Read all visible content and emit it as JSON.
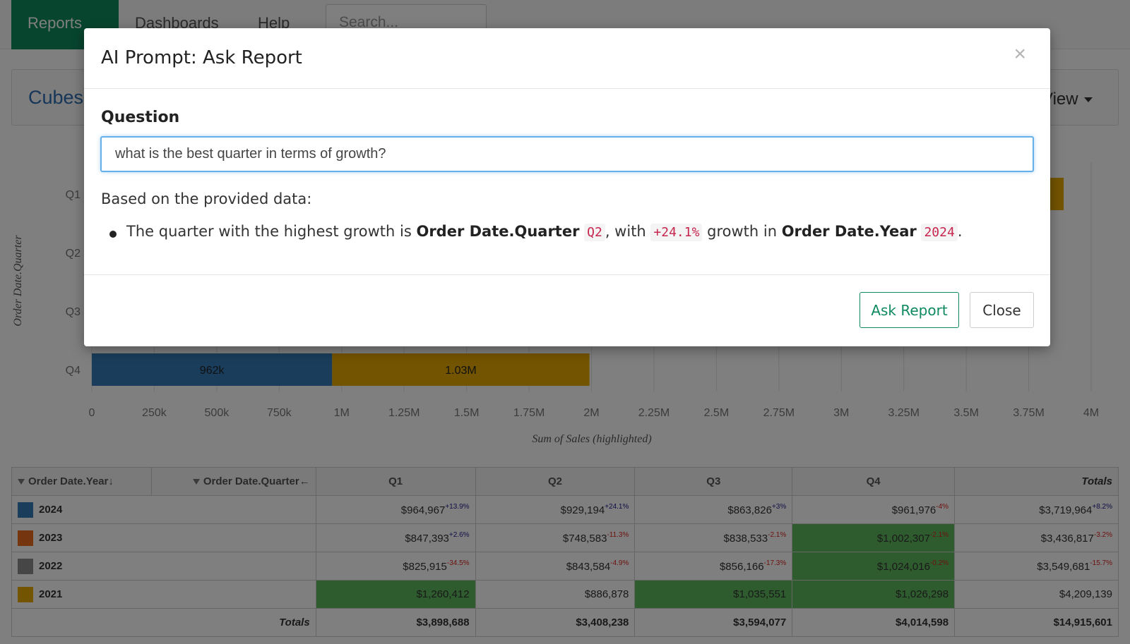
{
  "nav": {
    "reports": "Reports",
    "dashboards": "Dashboards",
    "help": "Help",
    "search_placeholder": "Search..."
  },
  "panel": {
    "title": "Cubes",
    "view_menu": "View"
  },
  "chart_data": {
    "type": "bar",
    "orientation": "horizontal",
    "stacked": true,
    "categories": [
      "Q1",
      "Q2",
      "Q3",
      "Q4"
    ],
    "ylabel": "Order Date.Quarter",
    "xlabel": "Sum of Sales (highlighted)",
    "xlim": [
      0,
      4000000
    ],
    "xticks": [
      "0",
      "250k",
      "500k",
      "750k",
      "1M",
      "1.25M",
      "1.5M",
      "1.75M",
      "2M",
      "2.25M",
      "2.5M",
      "2.75M",
      "3M",
      "3.25M",
      "3.5M",
      "3.75M",
      "4M"
    ],
    "grid": true,
    "series": [
      {
        "values": [
          null,
          null,
          null,
          962000
        ],
        "labels": [
          "",
          "",
          "",
          "962k"
        ],
        "color": "#337ab7"
      },
      {
        "values": [
          null,
          null,
          null,
          1030000
        ],
        "labels": [
          "",
          "",
          "",
          "1.03M"
        ],
        "color": "#e6a800"
      }
    ],
    "q1_right_edge_visible_value": 3890000
  },
  "table": {
    "header": {
      "year_label": "Order Date.Year",
      "year_sort": "↓",
      "quarter_label": "Order Date.Quarter",
      "quarter_sort": "←",
      "cols": [
        "Q1",
        "Q2",
        "Q3",
        "Q4"
      ],
      "totals": "Totals"
    },
    "rows": [
      {
        "year": "2024",
        "color": "#337ab7",
        "cells": [
          {
            "value": "$964,967",
            "delta": "+13.9%",
            "sign": "pos",
            "highlight": false
          },
          {
            "value": "$929,194",
            "delta": "+24.1%",
            "sign": "pos",
            "highlight": false
          },
          {
            "value": "$863,826",
            "delta": "+3%",
            "sign": "pos",
            "highlight": false
          },
          {
            "value": "$961,976",
            "delta": "-4%",
            "sign": "neg",
            "highlight": false
          },
          {
            "value": "$3,719,964",
            "delta": "+8.2%",
            "sign": "pos",
            "highlight": false
          }
        ]
      },
      {
        "year": "2023",
        "color": "#e86b1f",
        "cells": [
          {
            "value": "$847,393",
            "delta": "+2.6%",
            "sign": "pos",
            "highlight": false
          },
          {
            "value": "$748,583",
            "delta": "-11.3%",
            "sign": "neg",
            "highlight": false
          },
          {
            "value": "$838,533",
            "delta": "-2.1%",
            "sign": "neg",
            "highlight": false
          },
          {
            "value": "$1,002,307",
            "delta": "-2.1%",
            "sign": "neg",
            "highlight": true
          },
          {
            "value": "$3,436,817",
            "delta": "-3.2%",
            "sign": "neg",
            "highlight": false
          }
        ]
      },
      {
        "year": "2022",
        "color": "#8c8c8c",
        "cells": [
          {
            "value": "$825,915",
            "delta": "-34.5%",
            "sign": "neg",
            "highlight": false
          },
          {
            "value": "$843,584",
            "delta": "-4.9%",
            "sign": "neg",
            "highlight": false
          },
          {
            "value": "$856,166",
            "delta": "-17.3%",
            "sign": "neg",
            "highlight": false
          },
          {
            "value": "$1,024,016",
            "delta": "-0.2%",
            "sign": "neg",
            "highlight": true
          },
          {
            "value": "$3,549,681",
            "delta": "-15.7%",
            "sign": "neg",
            "highlight": false
          }
        ]
      },
      {
        "year": "2021",
        "color": "#e6a800",
        "cells": [
          {
            "value": "$1,260,412",
            "delta": "",
            "sign": "",
            "highlight": true
          },
          {
            "value": "$886,878",
            "delta": "",
            "sign": "",
            "highlight": false
          },
          {
            "value": "$1,035,551",
            "delta": "",
            "sign": "",
            "highlight": true
          },
          {
            "value": "$1,026,298",
            "delta": "",
            "sign": "",
            "highlight": true
          },
          {
            "value": "$4,209,139",
            "delta": "",
            "sign": "",
            "highlight": false
          }
        ]
      }
    ],
    "totals_row": {
      "label": "Totals",
      "values": [
        "$3,898,688",
        "$3,408,238",
        "$3,594,077",
        "$4,014,598",
        "$14,915,601"
      ]
    }
  },
  "modal": {
    "title": "AI Prompt: Ask Report",
    "close_glyph": "×",
    "question_label": "Question",
    "question_value": "what is the best quarter in terms of growth?",
    "answer_intro": "Based on the provided data:",
    "answer": {
      "t1": "The quarter with the highest growth is ",
      "b1": "Order Date.Quarter",
      "c1": "Q2",
      "t2": ", with ",
      "c2": "+24.1%",
      "t3": " growth in ",
      "b2": "Order Date.Year",
      "c3": "2024",
      "t4": "."
    },
    "ask_button": "Ask Report",
    "close_button": "Close"
  }
}
